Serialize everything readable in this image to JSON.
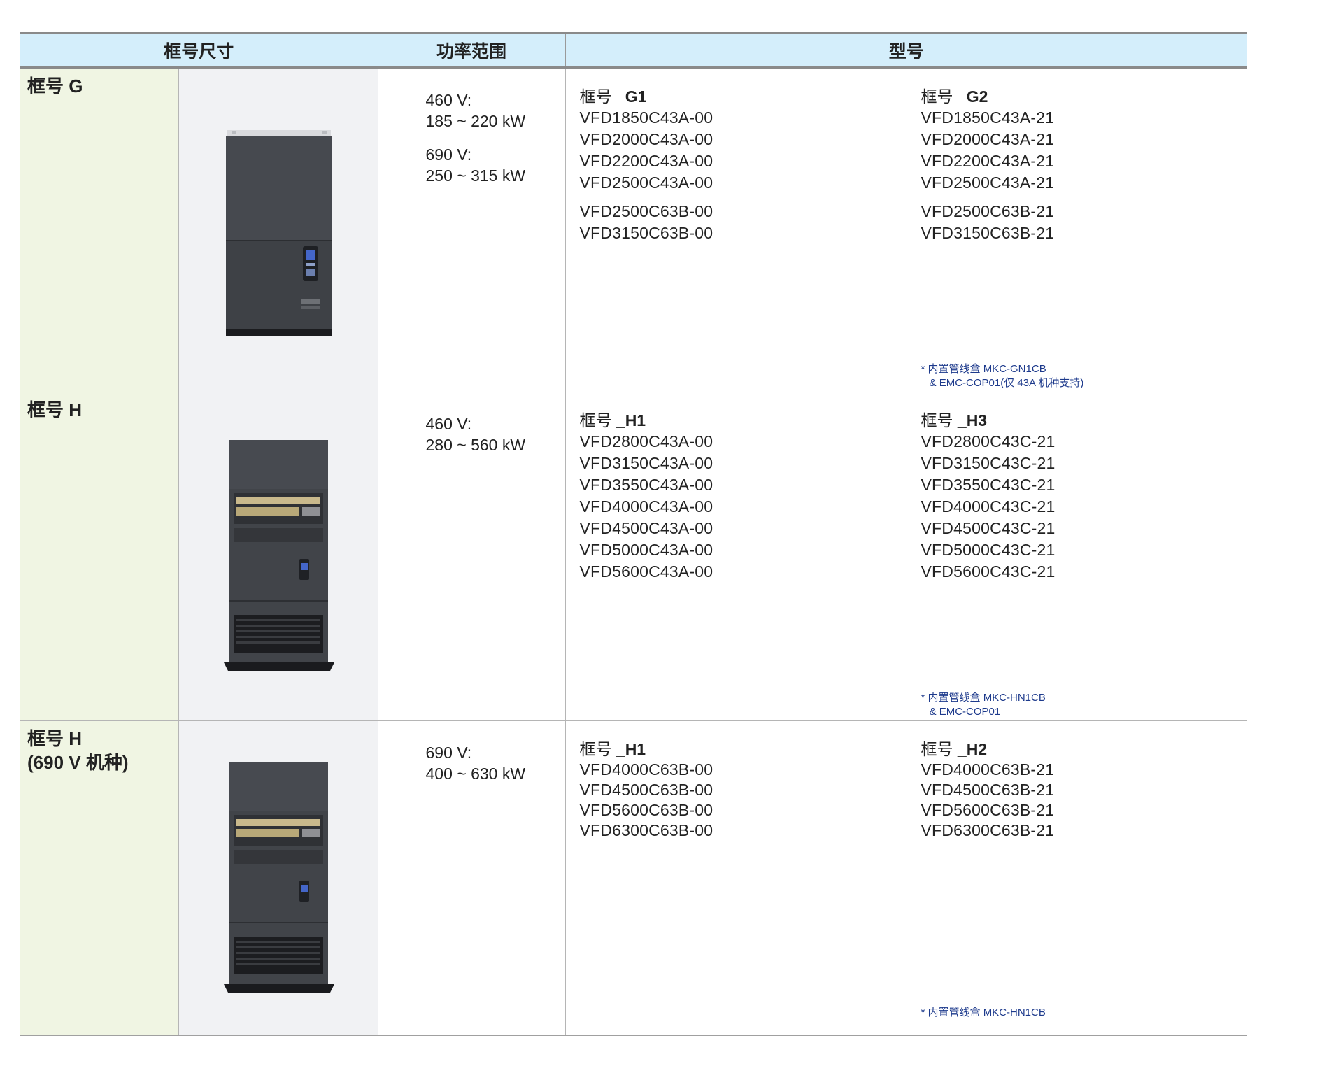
{
  "header": {
    "col1": "框号尺寸",
    "col2": "功率范围",
    "col3": "型号"
  },
  "rows": [
    {
      "frame": "框号 G",
      "frame_sub": "",
      "power": [
        {
          "voltage": "460 V:",
          "range": "185 ~ 220 kW"
        },
        {
          "voltage": "690 V:",
          "range": "250 ~ 315 kW"
        }
      ],
      "left": {
        "title_prefix": "框号",
        "title_code": "_G1",
        "models": [
          "VFD1850C43A-00",
          "VFD2000C43A-00",
          "VFD2200C43A-00",
          "VFD2500C43A-00",
          "VFD2500C63B-00",
          "VFD3150C63B-00"
        ]
      },
      "right": {
        "title_prefix": "框号",
        "title_code": "_G2",
        "models": [
          "VFD1850C43A-21",
          "VFD2000C43A-21",
          "VFD2200C43A-21",
          "VFD2500C43A-21",
          "VFD2500C63B-21",
          "VFD3150C63B-21"
        ],
        "note_line1": "* 内置管线盒 MKC-GN1CB",
        "note_line2": "& EMC-COP01(仅 43A 机种支持)"
      }
    },
    {
      "frame": "框号 H",
      "frame_sub": "",
      "power": [
        {
          "voltage": "460 V:",
          "range": "280 ~ 560 kW"
        }
      ],
      "left": {
        "title_prefix": "框号",
        "title_code": "_H1",
        "models": [
          "VFD2800C43A-00",
          "VFD3150C43A-00",
          "VFD3550C43A-00",
          "VFD4000C43A-00",
          "VFD4500C43A-00",
          "VFD5000C43A-00",
          "VFD5600C43A-00"
        ]
      },
      "right": {
        "title_prefix": "框号",
        "title_code": "_H3",
        "models": [
          "VFD2800C43C-21",
          "VFD3150C43C-21",
          "VFD3550C43C-21",
          "VFD4000C43C-21",
          "VFD4500C43C-21",
          "VFD5000C43C-21",
          "VFD5600C43C-21"
        ],
        "note_line1": "* 内置管线盒 MKC-HN1CB",
        "note_line2": "& EMC-COP01"
      }
    },
    {
      "frame": "框号 H",
      "frame_sub": "(690 V 机种)",
      "power": [
        {
          "voltage": "690 V:",
          "range": "400 ~ 630 kW"
        }
      ],
      "left": {
        "title_prefix": "框号",
        "title_code": "_H1",
        "models": [
          "VFD4000C63B-00",
          "VFD4500C63B-00",
          "VFD5600C63B-00",
          "VFD6300C63B-00"
        ]
      },
      "right": {
        "title_prefix": "框号",
        "title_code": "_H2",
        "models": [
          "VFD4000C63B-21",
          "VFD4500C63B-21",
          "VFD5600C63B-21",
          "VFD6300C63B-21"
        ],
        "note_line1": "* 内置管线盒 MKC-HN1CB",
        "note_line2": ""
      }
    }
  ]
}
